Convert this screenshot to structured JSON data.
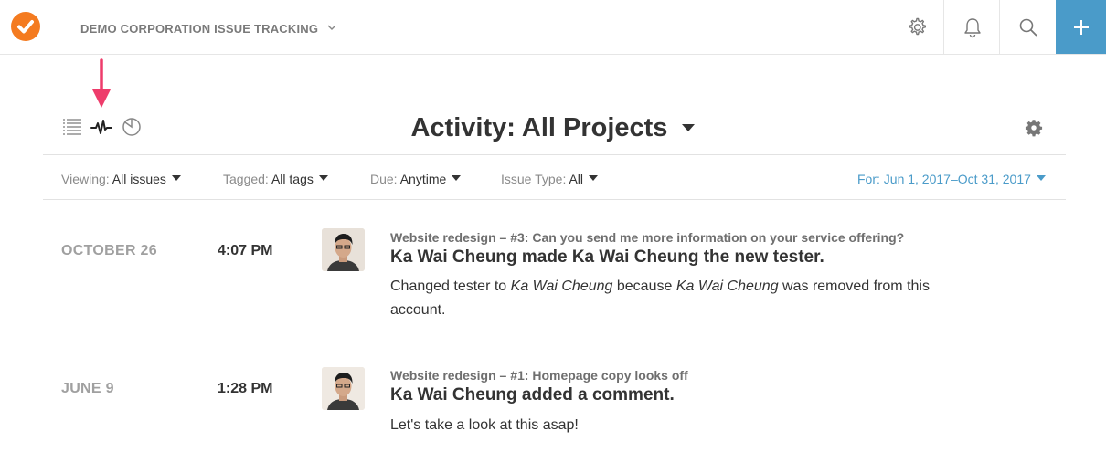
{
  "topbar": {
    "org_title": "DEMO CORPORATION ISSUE TRACKING",
    "accent": "#4a9bc9",
    "logo_color": "#f47b20",
    "buttons": [
      "gear-icon",
      "bell-icon",
      "search-icon",
      "plus-icon"
    ]
  },
  "page": {
    "title": "Activity: All Projects",
    "view_icons": [
      "list-icon",
      "activity-icon",
      "pie-chart-icon"
    ],
    "annotation_color": "#ee3c6b"
  },
  "filters": [
    {
      "label": "Viewing:",
      "value": "All issues"
    },
    {
      "label": "Tagged:",
      "value": "All tags"
    },
    {
      "label": "Due:",
      "value": "Anytime"
    },
    {
      "label": "Issue Type:",
      "value": "All"
    }
  ],
  "date_filter": {
    "label": "For:",
    "value": "Jun 1, 2017–Oct 31, 2017"
  },
  "activity": [
    {
      "date": "OCTOBER 26",
      "time": "4:07 PM",
      "meta": "Website redesign – #3: Can you send me more information on your service offering?",
      "headline": "Ka Wai Cheung made Ka Wai Cheung the new tester.",
      "body": {
        "t1": "Changed tester to ",
        "name1": "Ka Wai Cheung",
        "t2": " because ",
        "name2": "Ka Wai Cheung",
        "t3": " was removed from this account."
      }
    },
    {
      "date": "JUNE 9",
      "time": "1:28 PM",
      "meta": "Website redesign – #1: Homepage copy looks off",
      "headline": "Ka Wai Cheung added a comment.",
      "body": {
        "text": "Let's take a look at this asap!"
      }
    }
  ]
}
